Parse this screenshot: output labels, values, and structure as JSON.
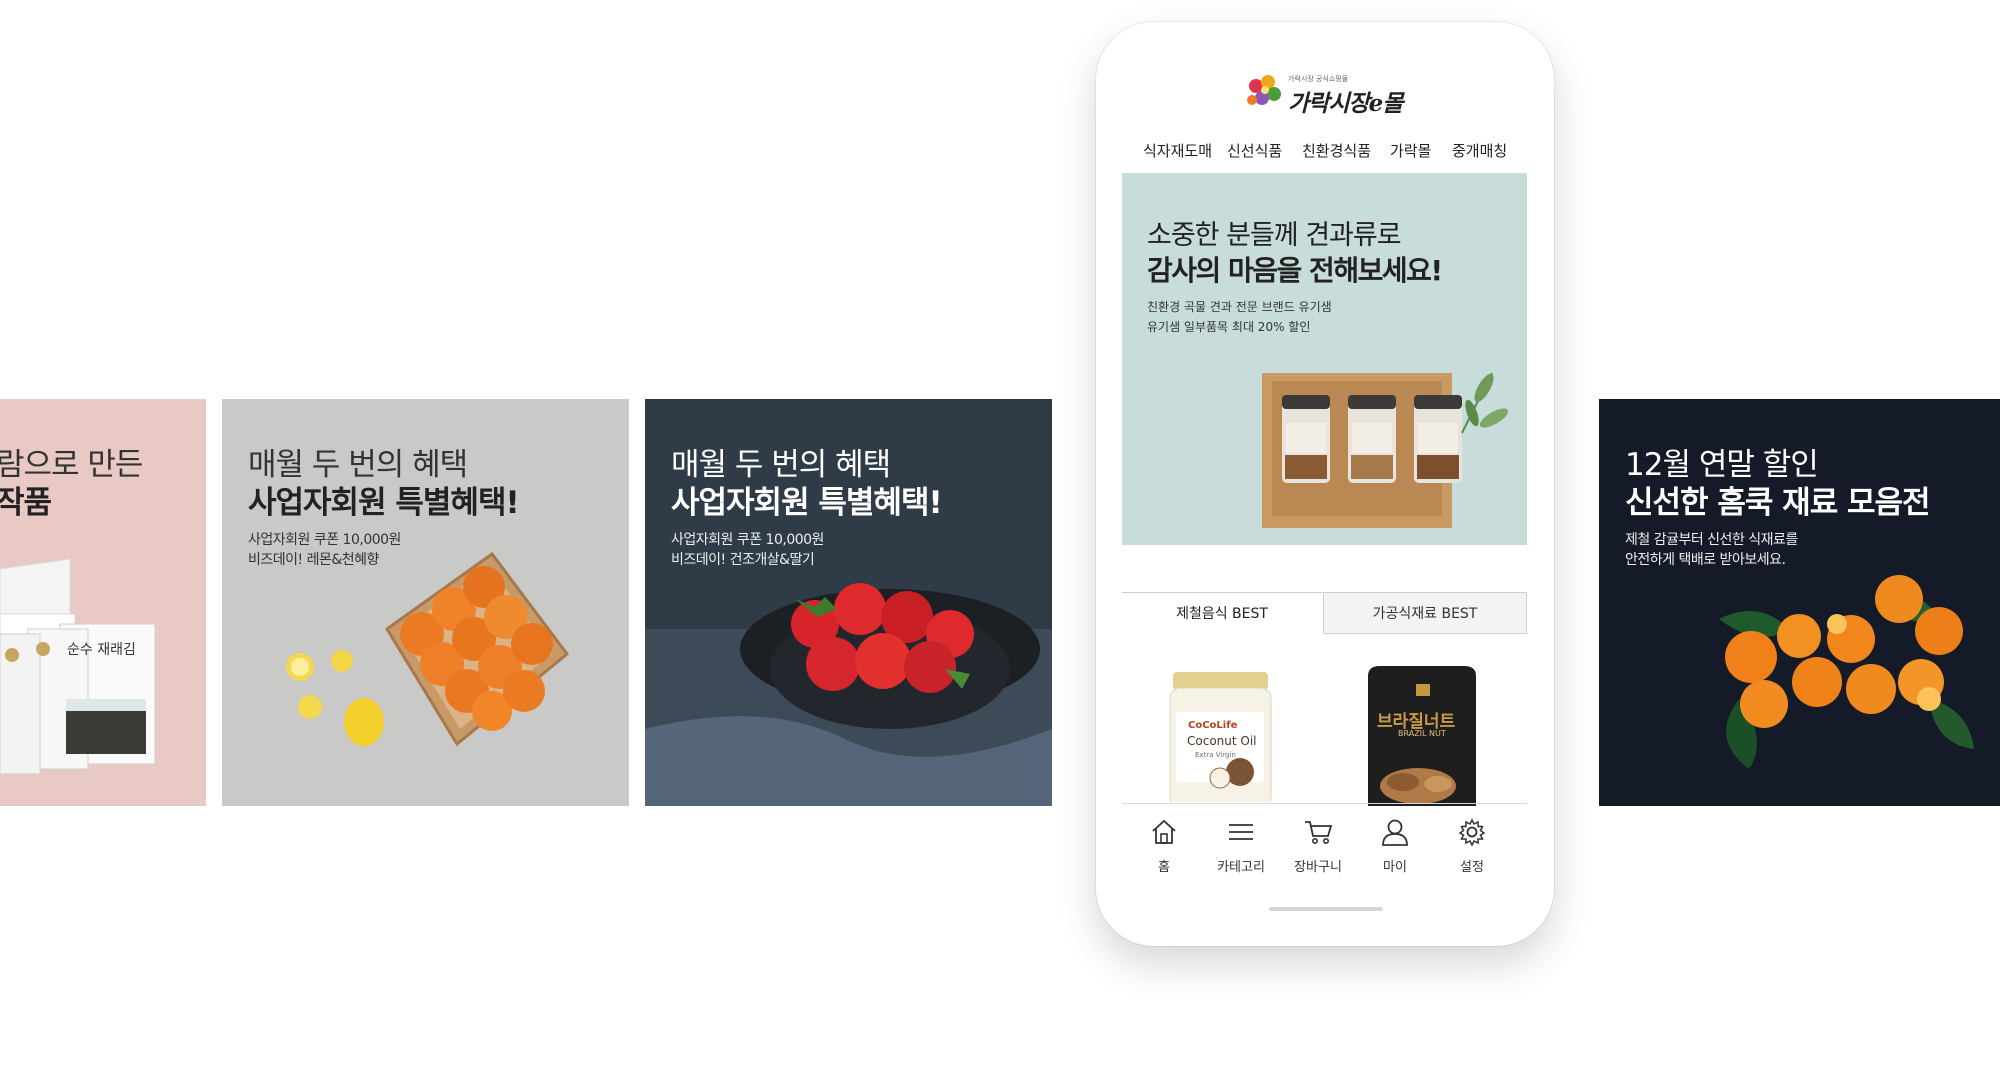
{
  "cards": [
    {
      "title1": "람으로 만든",
      "title2": "작품",
      "bg": "#e8c9c4"
    },
    {
      "title1": "매월 두 번의 혜택",
      "title2": "사업자회원 특별혜택!",
      "sub1": "사업자회원 쿠폰 10,000원",
      "sub2": "비즈데이! 레몬&천혜향",
      "bg": "#c9c9c7"
    },
    {
      "title1": "매월 두 번의 혜택",
      "title2": "사업자회원 특별혜택!",
      "sub1": "사업자회원 쿠폰 10,000원",
      "sub2": "비즈데이! 건조개살&딸기",
      "bg": "#2f3b47"
    },
    {
      "title1": "12월 연말 할인",
      "title2": "신선한 홈쿡 재료 모음전",
      "sub1": "제철 감귤부터 신선한 식재료를",
      "sub2": "안전하게 택배로 받아보세요.",
      "bg": "#141a28"
    }
  ],
  "product_labels": {
    "seaweed": "순수 재래김",
    "coconut_brand": "CoCoLife",
    "coconut_name": "Coconut Oil",
    "coconut_sub": "Extra Virgin",
    "nut_kr": "브라질너트",
    "nut_en": "BRAZIL NUT"
  },
  "app": {
    "logo_tagline": "가락시장 공식쇼핑몰",
    "logo_text": "가락시장e몰",
    "nav": [
      "식자재도매",
      "신선식품",
      "친환경식품",
      "가락몰",
      "중개매칭"
    ],
    "banner": {
      "line1": "소중한 분들께 견과류로",
      "line2": "감사의 마음을 전해보세요!",
      "sub1": "친환경 곡물 견과 전문 브랜드 유기샘",
      "sub2": "유기샘 일부품목 최대 20% 할인",
      "bg": "#c7dcdb"
    },
    "tabs": [
      "제철음식 BEST",
      "가공식재료 BEST"
    ],
    "bottom_nav": [
      {
        "label": "홈",
        "icon": "home-icon"
      },
      {
        "label": "카테고리",
        "icon": "menu-icon"
      },
      {
        "label": "장바구니",
        "icon": "cart-icon"
      },
      {
        "label": "마이",
        "icon": "user-icon"
      },
      {
        "label": "설정",
        "icon": "gear-icon"
      }
    ]
  }
}
